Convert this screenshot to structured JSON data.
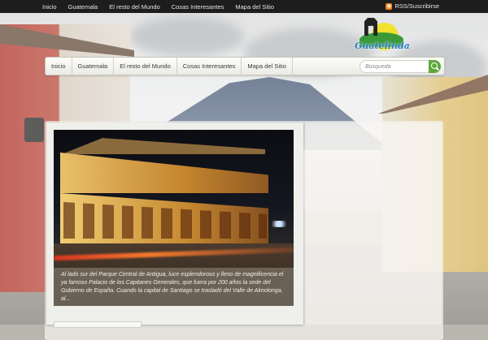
{
  "topbar": {
    "links": [
      "Inicio",
      "Guatemala",
      "El resto del Mundo",
      "Cosas Interesantes",
      "Mapa del Sitio"
    ],
    "rss_label": "RSS/Suscribirse"
  },
  "logo": {
    "name": "Guatelinda"
  },
  "nav": {
    "items": [
      "Inicio",
      "Guatemala",
      "El resto del Mundo",
      "Cosas Interesantes",
      "Mapa del Sitio"
    ]
  },
  "search": {
    "placeholder": "Búsqueda",
    "icon": "search-icon"
  },
  "featured": {
    "caption": "Al lado sur del Parque Central de Antigua, luce esplendoroso y lleno de magnificencia el ya famoso Palacio de los Capitanes Generales, que fuera por 200 años la sede del Gobierno de España. Cuando la capital de Santiago se trasladó del Valle de Almolonga, al..."
  },
  "colors": {
    "topbar": "#1d1d1d",
    "rss": "#f08a24",
    "search_button": "#5fa83c",
    "logo_text": "#2a7fbf"
  }
}
